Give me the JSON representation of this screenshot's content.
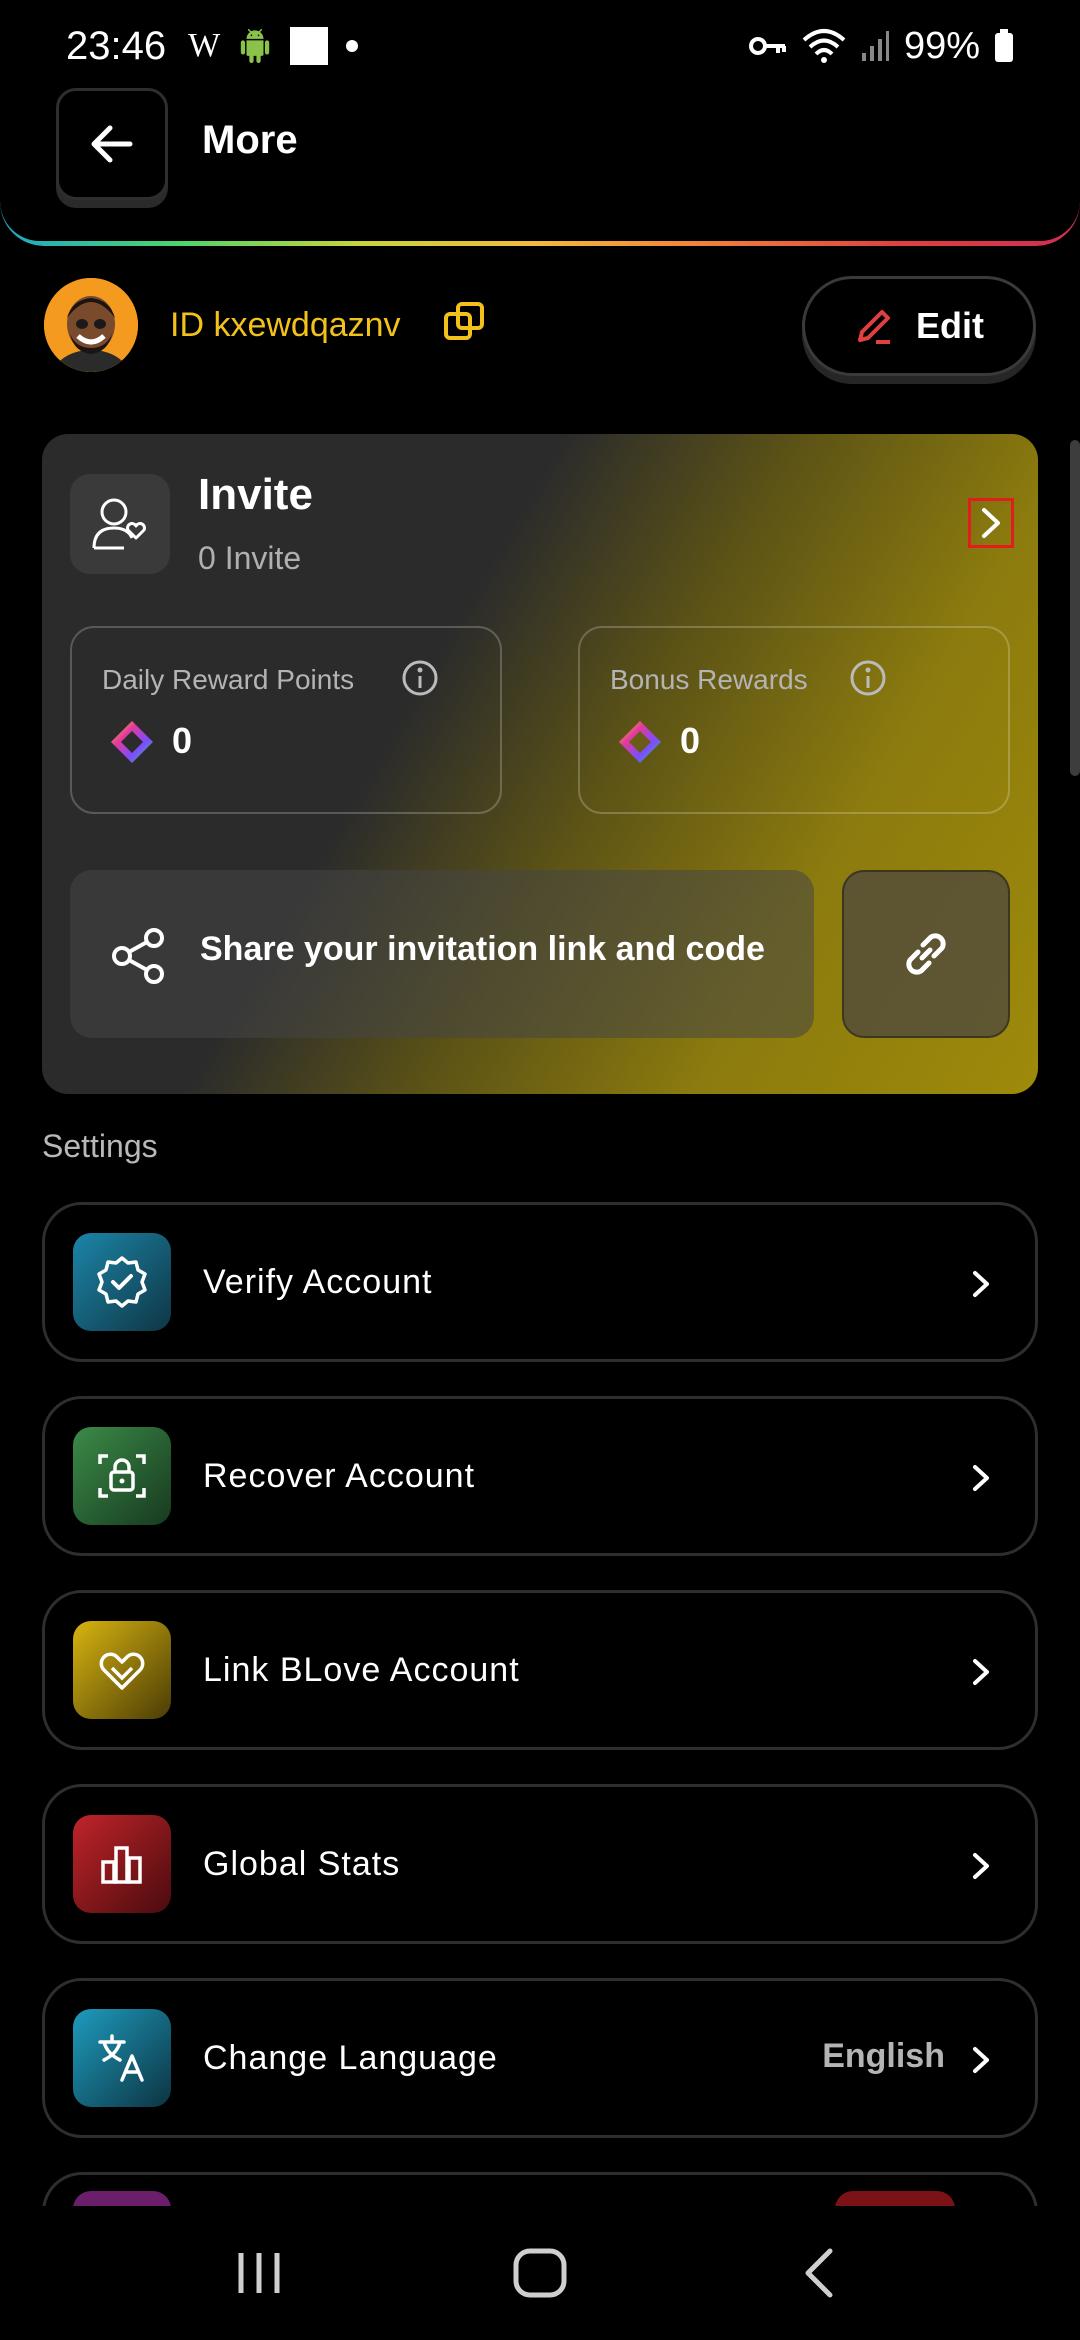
{
  "status_bar": {
    "time": "23:46",
    "icons_left": [
      "wikipedia-icon",
      "android-icon",
      "square-icon",
      "dot-icon"
    ],
    "icons_right": [
      "key-icon",
      "wifi-icon",
      "signal-icon"
    ],
    "battery": "99%"
  },
  "header": {
    "title": "More",
    "back_icon": "arrow-left-icon"
  },
  "profile": {
    "id_text": "ID kxewdqaznv",
    "edit_label": "Edit"
  },
  "invite": {
    "title": "Invite",
    "count_text": "0 Invite",
    "daily_label": "Daily Reward Points",
    "daily_value": "0",
    "bonus_label": "Bonus Rewards",
    "bonus_value": "0",
    "share_label": "Share your invitation link and code"
  },
  "settings": {
    "section_title": "Settings",
    "items": [
      {
        "label": "Verify Account",
        "icon": "verified-badge-icon",
        "value": ""
      },
      {
        "label": "Recover Account",
        "icon": "lock-scan-icon",
        "value": ""
      },
      {
        "label": "Link BLove Account",
        "icon": "heart-link-icon",
        "value": ""
      },
      {
        "label": "Global Stats",
        "icon": "bar-chart-icon",
        "value": ""
      },
      {
        "label": "Change Language",
        "icon": "translate-icon",
        "value": "English"
      }
    ]
  },
  "colors": {
    "accent_yellow": "#f2c21b",
    "verify": "#1a6f8c",
    "recover": "#2f6b3a",
    "blove": "#b59a0a",
    "stats": "#9b1b1f",
    "language": "#1a8aa8"
  }
}
